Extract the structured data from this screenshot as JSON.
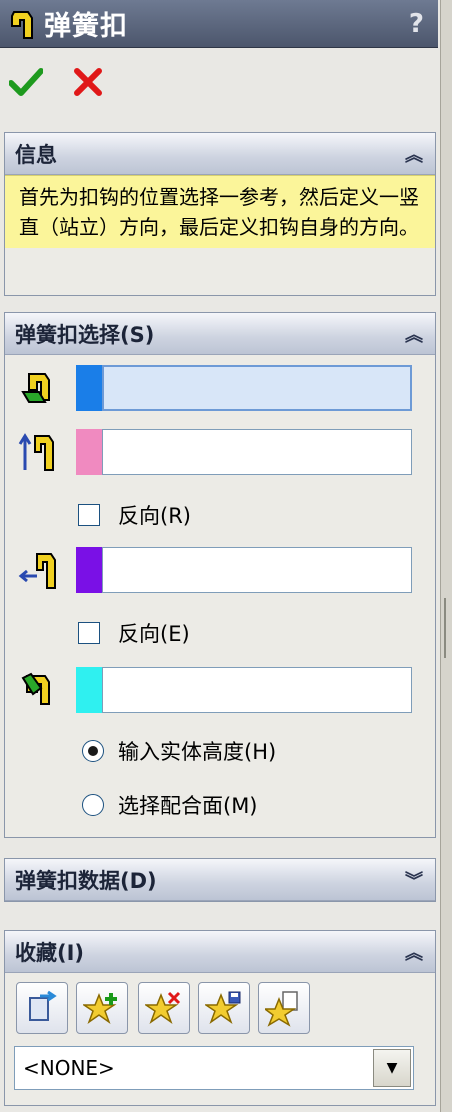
{
  "title": {
    "text": "弹簧扣",
    "help": "?"
  },
  "actions": {
    "ok_icon": "check-icon",
    "cancel_icon": "close-icon"
  },
  "info": {
    "header": "信息",
    "message": "首先为扣钩的位置选择一参考，然后定义一竖直（站立）方向，最后定义扣钩自身的方向。"
  },
  "selection": {
    "header": "弹簧扣选择(S)",
    "reverse1": "反向(R)",
    "reverse2": "反向(E)",
    "radio1": "输入实体高度(H)",
    "radio2": "选择配合面(M)",
    "colors": {
      "field1": "#1a7ee8",
      "field2": "#f08ac0",
      "field3": "#7a10e6",
      "field4": "#2ff0f0"
    }
  },
  "data_section": {
    "header": "弹簧扣数据(D)"
  },
  "favorites": {
    "header": "收藏(I)",
    "combo_value": "<NONE>"
  }
}
